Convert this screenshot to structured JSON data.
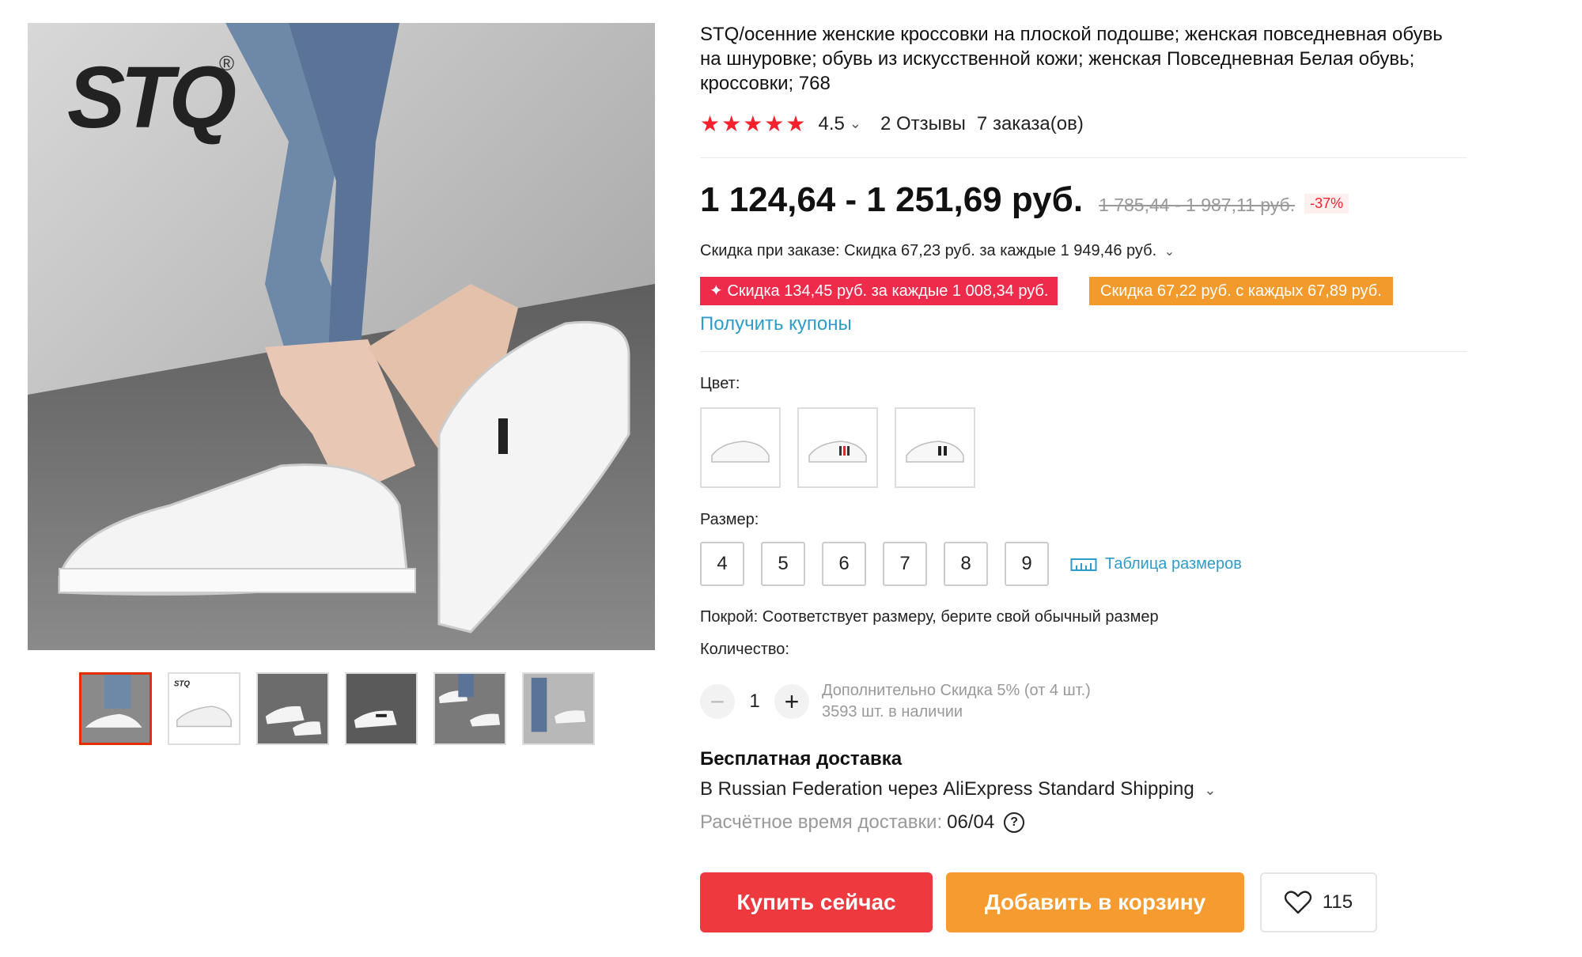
{
  "gallery": {
    "brand_logo": "STQ",
    "brand_reg_mark": "®",
    "thumbnails": [
      "thumb-1",
      "thumb-2",
      "thumb-3",
      "thumb-4",
      "thumb-5",
      "thumb-6"
    ],
    "active_thumbnail": 1
  },
  "product": {
    "title": "STQ/осенние женские кроссовки на плоской подошве; женская повседневная обувь на шнуровке; обувь из искусственной кожи; женская Повседневная Белая обувь; кроссовки; 768",
    "rating": "4.5",
    "reviews": "2 Отзывы",
    "orders": "7 заказа(ов)"
  },
  "price": {
    "current": "1 124,64 - 1 251,69 руб.",
    "old": "1 785,44 - 1 987,11 руб.",
    "discount": "-37%",
    "order_discount": "Скидка при заказе: Скидка 67,23 руб. за каждые 1 949,46 руб.",
    "coupon_red": "✦ Скидка 134,45 руб. за каждые 1 008,34 руб.",
    "coupon_orange": "Скидка 67,22 руб. с каждых 67,89 руб.",
    "get_coupons": "Получить купоны"
  },
  "options": {
    "color_label": "Цвет:",
    "colors": [
      "white-plain",
      "white-red-stripe",
      "white-black-stripe"
    ],
    "size_label": "Размер:",
    "sizes": [
      "4",
      "5",
      "6",
      "7",
      "8",
      "9"
    ],
    "size_table": "Таблица размеров",
    "fit": "Покрой: Соответствует размеру, берите свой обычный размер",
    "quantity_label": "Количество:",
    "quantity_value": "1",
    "quantity_minus": "−",
    "quantity_plus": "+",
    "extra_discount": "Дополнительно Скидка 5% (от 4 шт.)",
    "stock": "3593 шт. в наличии"
  },
  "shipping": {
    "title": "Бесплатная доставка",
    "line": "В Russian Federation через AliExpress Standard Shipping",
    "time_label": "Расчётное время доставки:",
    "time_value": "06/04"
  },
  "actions": {
    "buy": "Купить сейчас",
    "cart": "Добавить в корзину",
    "wishlist_count": "115"
  },
  "colors": {
    "accent_red": "#ee3a3f",
    "accent_orange": "#f59b2f",
    "link_blue": "#2e9cca",
    "star_red": "#f5222d"
  }
}
